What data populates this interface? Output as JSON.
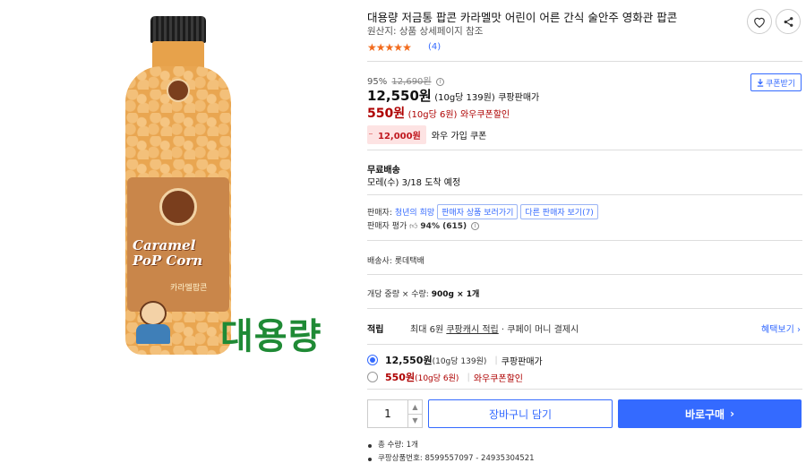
{
  "image": {
    "bottle_text": "Caramel PoP Corn",
    "bottle_sub": "카라멜팝콘",
    "overlay_text": "대용량"
  },
  "product": {
    "title": "대용량 저금통 팝콘 카라멜맛 어린이 어른 간식 술안주 영화관 팝콘",
    "origin": "원산지: 상품 상세페이지 참조",
    "rating_stars": 5,
    "review_count": "(4)"
  },
  "price": {
    "discount_rate": "95%",
    "original_price": "12,690원",
    "info_icon": "i",
    "sale_price": "12,550원",
    "unit_price": "(10g당 139원)",
    "seller_type": "쿠팡판매가",
    "wow_price": "550원",
    "wow_unit_price": "(10g당 6원)",
    "wow_label": "와우쿠폰할인",
    "coupon_amount": "12,000원",
    "coupon_text": "와우 가입 쿠폰",
    "coupon_button": "쿠폰받기"
  },
  "shipping": {
    "title": "무료배송",
    "arrival": "모레(수) 3/18 도착 예정",
    "carrier_label": "배송사: 롯데택배"
  },
  "seller": {
    "label": "판매자:",
    "name": "청년의 희망",
    "view_products": "판매자 상품 보러가기",
    "other_sellers": "다른 판매자 보기(7)",
    "rating_label": "판매자 평가",
    "rating_value": "94% (615)"
  },
  "quantity_info": {
    "label": "개당 중량 × 수량:",
    "value": "900g × 1개"
  },
  "points": {
    "title": "적립",
    "prefix": "최대 6원",
    "link": "쿠팡캐시 적립",
    "suffix": "· 쿠페이 머니 결제시",
    "benefit_link": "혜택보기 ›"
  },
  "options": [
    {
      "price": "12,550원",
      "unit": "(10g당 139원)",
      "tag": "쿠팡판매가",
      "selected": true
    },
    {
      "price": "550원",
      "unit": "(10g당 6원)",
      "tag": "와우쿠폰할인",
      "selected": false
    }
  ],
  "purchase": {
    "quantity": "1",
    "cart_button": "장바구니 담기",
    "buy_button": "바로구매",
    "buy_chevron": "›"
  },
  "details": {
    "total_qty": "총 수량: 1개",
    "product_no": "쿠팡상품번호: 8599557097 - 24935304521"
  },
  "colors": {
    "accent": "#346aff",
    "wow_red": "#ae0000",
    "star": "#f26b1d",
    "overlay_green": "#1f8a35"
  }
}
